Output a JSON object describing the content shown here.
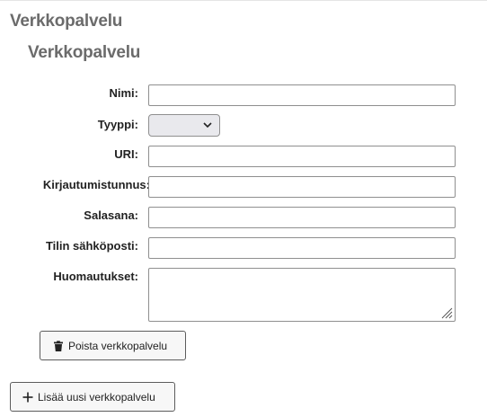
{
  "page": {
    "title": "Verkkopalvelu",
    "section_title": "Verkkopalvelu"
  },
  "form": {
    "name_label": "Nimi:",
    "name_value": "",
    "type_label": "Tyyppi:",
    "type_value": "",
    "uri_label": "URI:",
    "uri_value": "",
    "username_label": "Kirjautumistunnus:",
    "username_value": "",
    "password_label": "Salasana:",
    "password_value": "",
    "email_label": "Tilin sähköposti:",
    "email_value": "",
    "notes_label": "Huomautukset:",
    "notes_value": ""
  },
  "actions": {
    "remove_label": "Poista verkkopalvelu",
    "add_label": "Lisää uusi verkkopalvelu"
  },
  "icons": {
    "remove": "trash-icon",
    "add": "plus-icon",
    "select": "chevron-down-icon",
    "resize": "resize-grip-icon"
  }
}
